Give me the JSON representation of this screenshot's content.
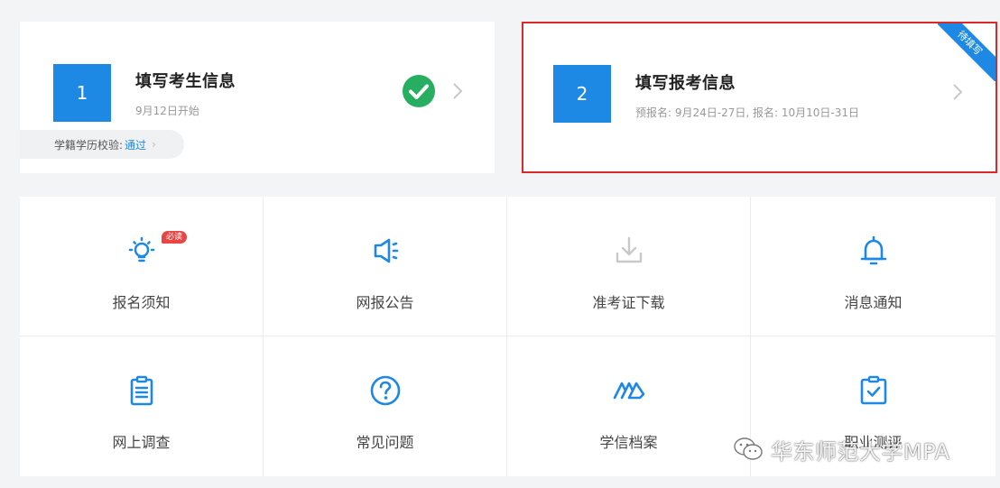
{
  "cards": [
    {
      "number": "1",
      "title": "填写考生信息",
      "subtitle": "9月12日开始",
      "verify_label": "学籍学历校验:",
      "verify_value": "通过",
      "completed": true
    },
    {
      "number": "2",
      "title": "填写报考信息",
      "subtitle": "预报名: 9月24日-27日, 报名: 10月10日-31日",
      "ribbon": "待填写",
      "highlight_color": "#d9292b"
    }
  ],
  "grid": [
    {
      "label": "报名须知",
      "icon": "lightbulb-icon",
      "badge": "必读"
    },
    {
      "label": "网报公告",
      "icon": "speaker-icon"
    },
    {
      "label": "准考证下载",
      "icon": "download-icon",
      "disabled": true
    },
    {
      "label": "消息通知",
      "icon": "bell-icon"
    },
    {
      "label": "网上调查",
      "icon": "clipboard-icon"
    },
    {
      "label": "常见问题",
      "icon": "question-icon"
    },
    {
      "label": "学信档案",
      "icon": "archive-icon"
    },
    {
      "label": "职业测评",
      "icon": "clipboard-check-icon"
    }
  ],
  "watermark": "华东师范大学MPA",
  "colors": {
    "accent": "#1e88e5",
    "success": "#27ae60",
    "highlight": "#d9292b",
    "badge": "#e84545"
  }
}
